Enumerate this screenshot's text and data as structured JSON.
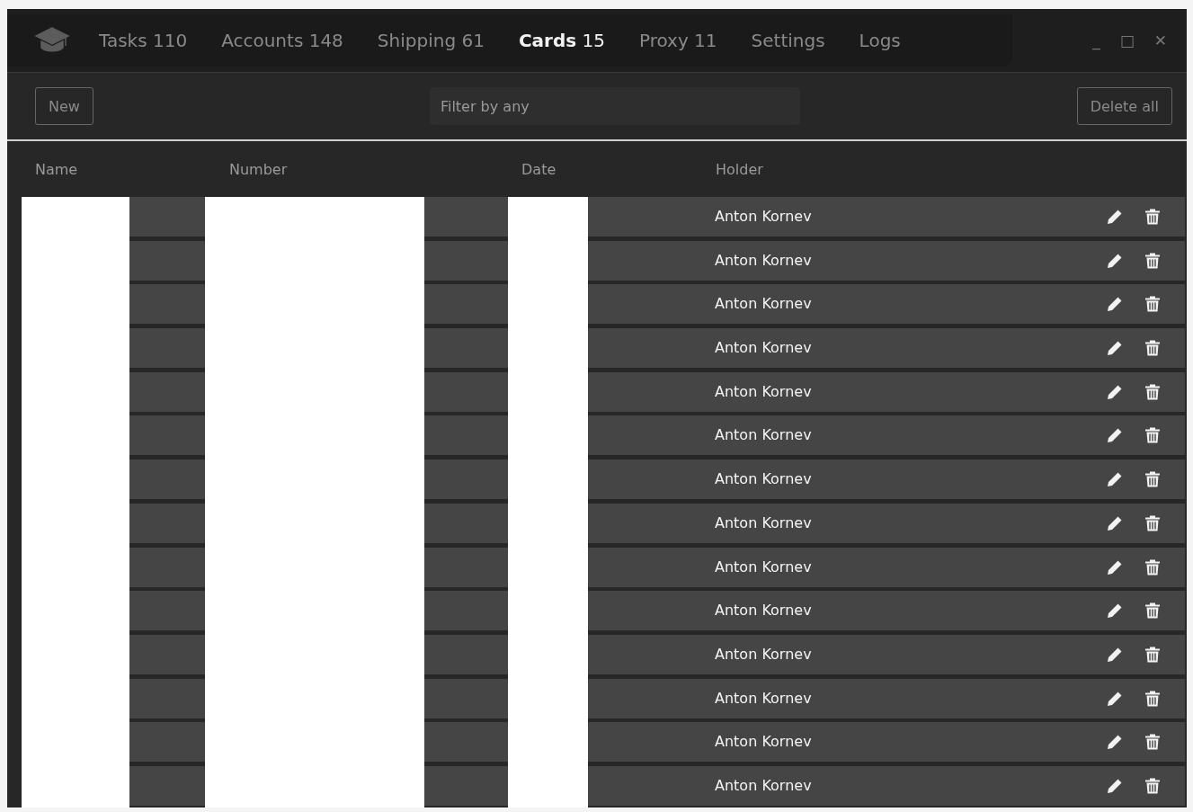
{
  "window": {
    "controls": [
      "_",
      "□",
      "✕"
    ]
  },
  "tabs": [
    {
      "label": "Tasks",
      "count": "110",
      "selected": false
    },
    {
      "label": "Accounts",
      "count": "148",
      "selected": false
    },
    {
      "label": "Shipping",
      "count": "61",
      "selected": false
    },
    {
      "label": "Cards",
      "count": "15",
      "selected": true
    },
    {
      "label": "Proxy",
      "count": "11",
      "selected": false
    },
    {
      "label": "Settings",
      "selected": false
    },
    {
      "label": "Logs",
      "selected": false
    }
  ],
  "toolbar": {
    "new_button": "New",
    "filter": {
      "placeholder": "Filter by any"
    },
    "delete_all_button": "Delete all"
  },
  "table": {
    "columns": [
      {
        "label": "Name",
        "redacted": true
      },
      {
        "label": "Number",
        "redacted": true
      },
      {
        "label": "Date",
        "redacted": true
      },
      {
        "label": "Holder",
        "redacted": false
      }
    ],
    "rows": [
      {
        "holder": "Anton Kornev"
      },
      {
        "holder": "Anton Kornev"
      },
      {
        "holder": "Anton Kornev"
      },
      {
        "holder": "Anton Kornev"
      },
      {
        "holder": "Anton Kornev"
      },
      {
        "holder": "Anton Kornev"
      },
      {
        "holder": "Anton Kornev"
      },
      {
        "holder": "Anton Kornev"
      },
      {
        "holder": "Anton Kornev"
      },
      {
        "holder": "Anton Kornev"
      },
      {
        "holder": "Anton Kornev"
      },
      {
        "holder": "Anton Kornev"
      },
      {
        "holder": "Anton Kornev"
      },
      {
        "holder": "Anton Kornev"
      }
    ]
  }
}
